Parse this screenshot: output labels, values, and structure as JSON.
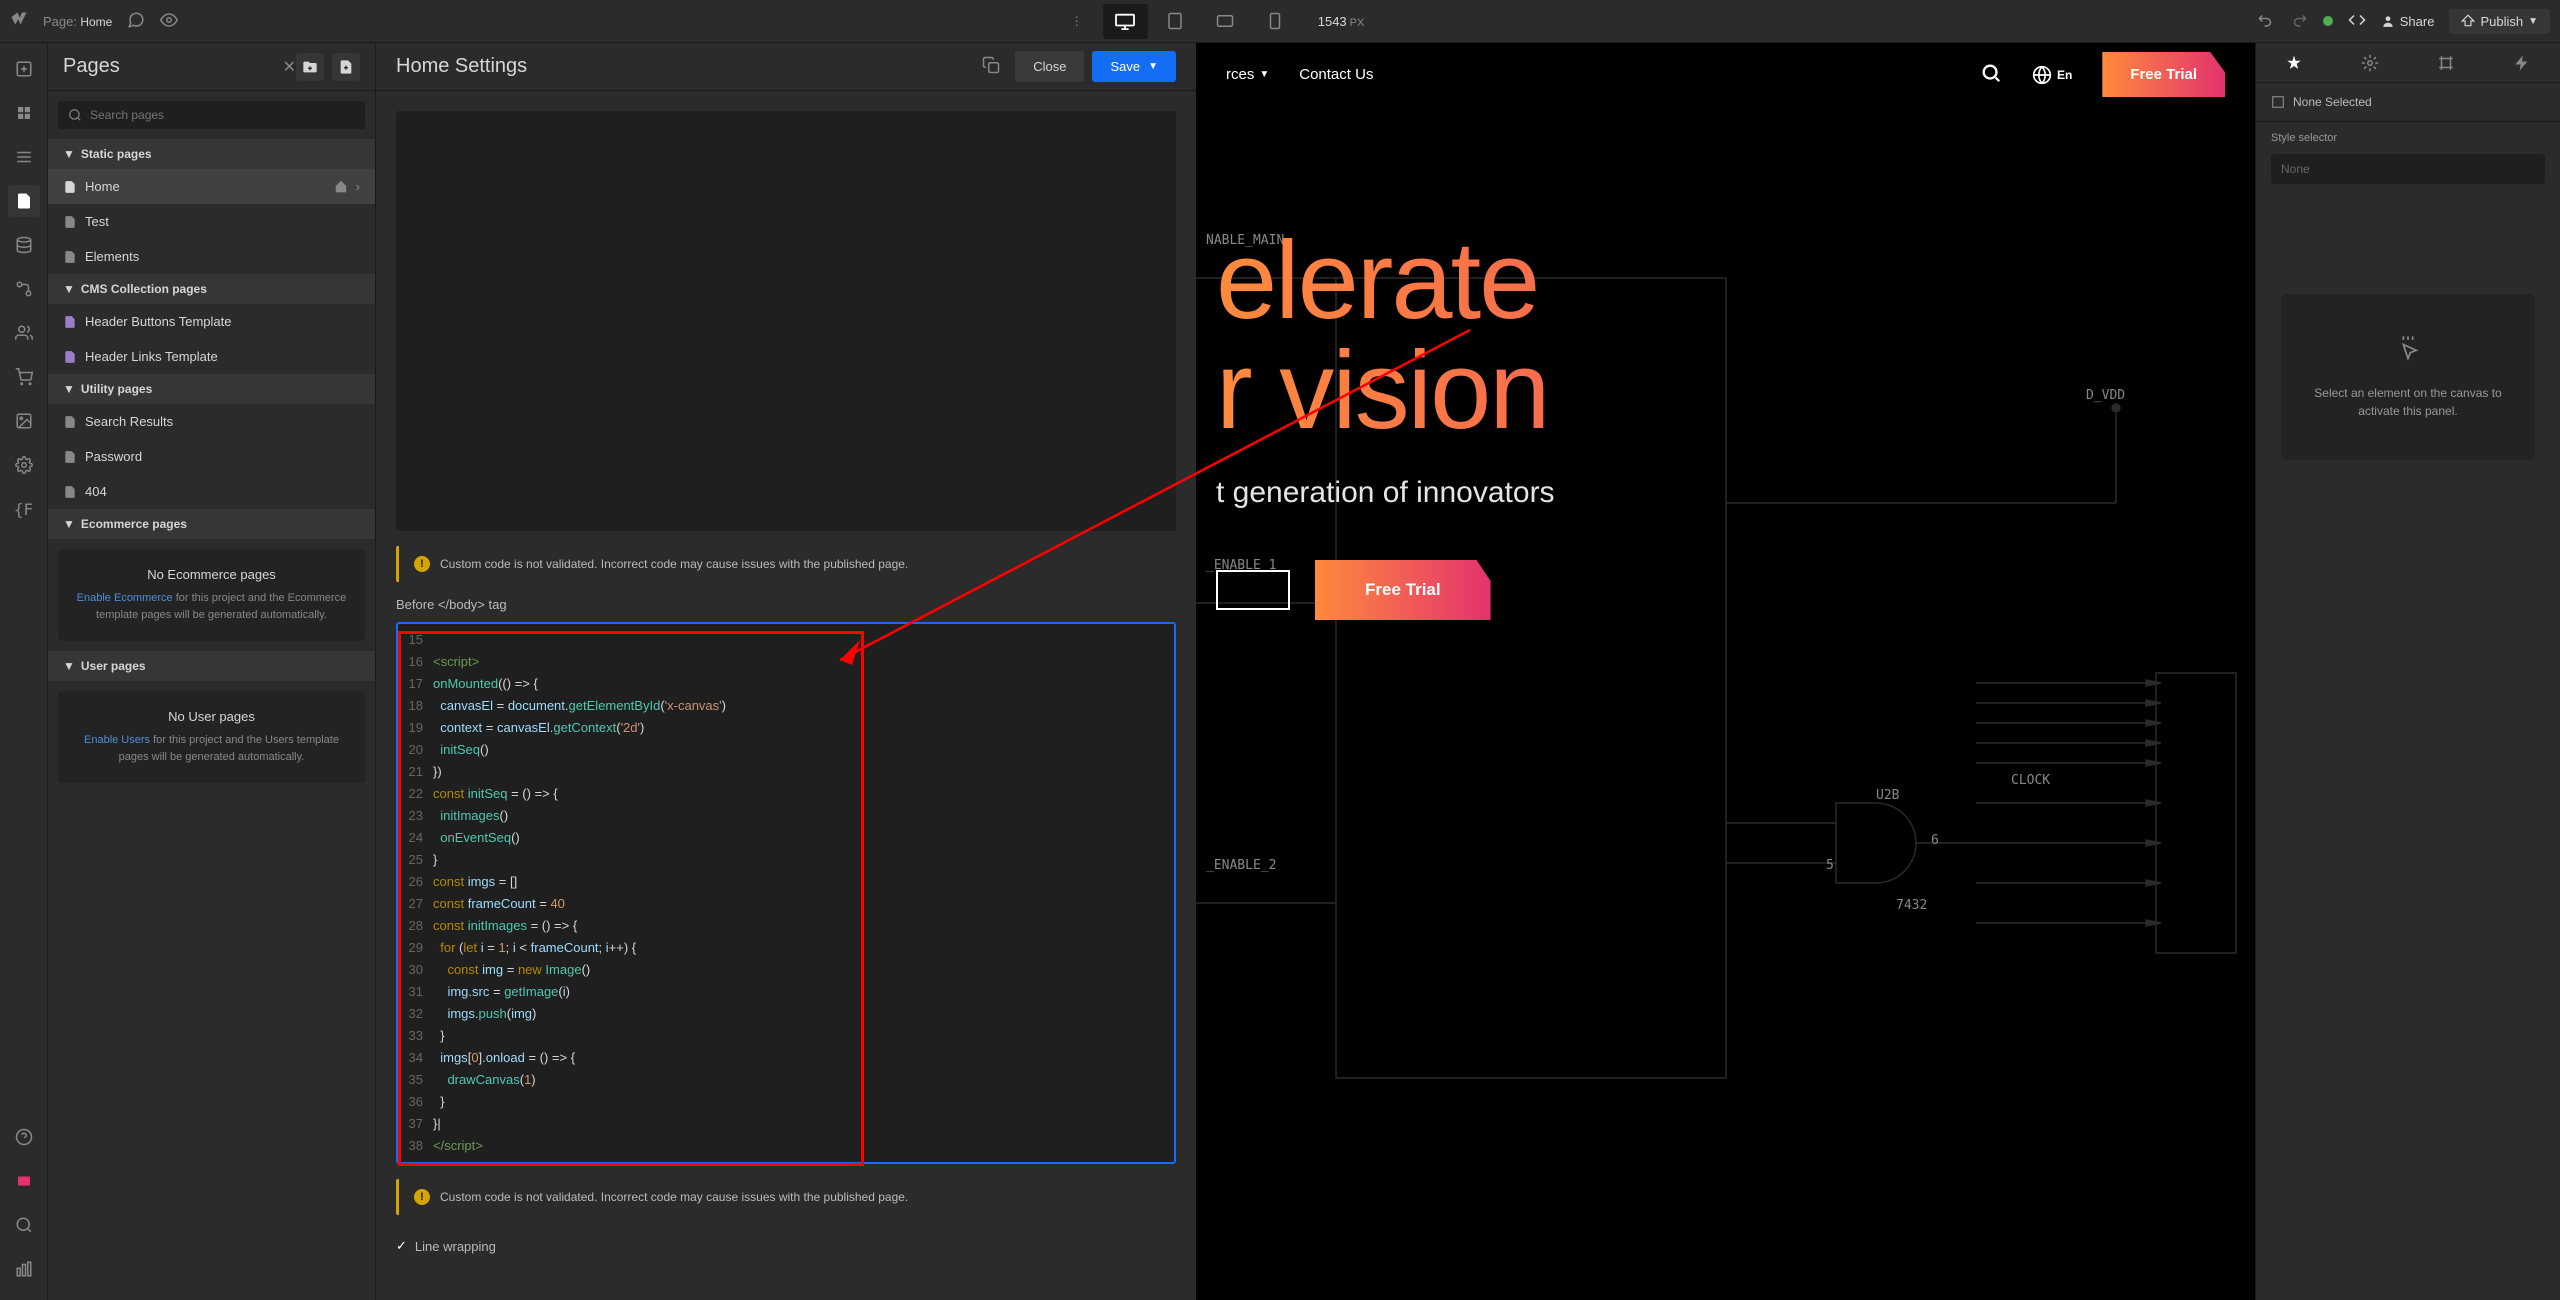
{
  "topbar": {
    "page_label": "Page:",
    "page_name": "Home",
    "viewport_width": "1543",
    "viewport_unit": "PX",
    "share": "Share",
    "publish": "Publish"
  },
  "pages_panel": {
    "title": "Pages",
    "search_placeholder": "Search pages",
    "sections": {
      "static": "Static pages",
      "cms": "CMS Collection pages",
      "utility": "Utility pages",
      "ecommerce": "Ecommerce pages",
      "user": "User pages"
    },
    "static_pages": [
      "Home",
      "Test",
      "Elements"
    ],
    "cms_pages": [
      "Header Buttons Template",
      "Header Links Template"
    ],
    "utility_pages": [
      "Search Results",
      "Password",
      "404"
    ],
    "ecom_box": {
      "title": "No Ecommerce pages",
      "link": "Enable Ecommerce",
      "text": " for this project and the Ecommerce template pages will be generated automatically."
    },
    "user_box": {
      "title": "No User pages",
      "link": "Enable Users",
      "text": " for this project and the Users template pages will be generated automatically."
    }
  },
  "settings": {
    "title": "Home Settings",
    "close": "Close",
    "save": "Save",
    "warning": "Custom code is not validated. Incorrect code may cause issues with the published page.",
    "before_body_label": "Before </body> tag",
    "line_wrapping": "Line wrapping",
    "code_lines": [
      {
        "n": "15",
        "t": ""
      },
      {
        "n": "16",
        "t": "<script>"
      },
      {
        "n": "17",
        "t": "onMounted(() => {"
      },
      {
        "n": "18",
        "t": "  canvasEl = document.getElementById('x-canvas')"
      },
      {
        "n": "19",
        "t": "  context = canvasEl.getContext('2d')"
      },
      {
        "n": "20",
        "t": "  initSeq()"
      },
      {
        "n": "21",
        "t": "})"
      },
      {
        "n": "22",
        "t": "const initSeq = () => {"
      },
      {
        "n": "23",
        "t": "  initImages()"
      },
      {
        "n": "24",
        "t": "  onEventSeq()"
      },
      {
        "n": "25",
        "t": "}"
      },
      {
        "n": "26",
        "t": "const imgs = []"
      },
      {
        "n": "27",
        "t": "const frameCount = 40"
      },
      {
        "n": "28",
        "t": "const initImages = () => {"
      },
      {
        "n": "29",
        "t": "  for (let i = 1; i < frameCount; i++) {"
      },
      {
        "n": "30",
        "t": "    const img = new Image()"
      },
      {
        "n": "31",
        "t": "    img.src = getImage(i)"
      },
      {
        "n": "32",
        "t": "    imgs.push(img)"
      },
      {
        "n": "33",
        "t": "  }"
      },
      {
        "n": "34",
        "t": "  imgs[0].onload = () => {"
      },
      {
        "n": "35",
        "t": "    drawCanvas(1)"
      },
      {
        "n": "36",
        "t": "  }"
      },
      {
        "n": "37",
        "t": "}|"
      },
      {
        "n": "38",
        "t": "</script>"
      }
    ]
  },
  "canvas": {
    "nav_items": [
      "rces",
      "Contact Us"
    ],
    "lang": "En",
    "cta": "Free Trial",
    "hero_line1": "elerate",
    "hero_line2": "r vision",
    "hero_sub": "t generation of innovators",
    "hero_cta": "Free Trial",
    "circuit_labels": {
      "main": "NABLE_MAIN",
      "en1": "_ENABLE_1",
      "en2": "_ENABLE_2",
      "dvdd": "D_VDD",
      "clock": "CLOCK",
      "u2b": "U2B",
      "n5": "5",
      "n6": "6",
      "n7432": "7432"
    }
  },
  "right": {
    "none_selected": "None Selected",
    "style_selector": "Style selector",
    "style_none": "None",
    "hint": "Select an element on the canvas to activate this panel."
  }
}
